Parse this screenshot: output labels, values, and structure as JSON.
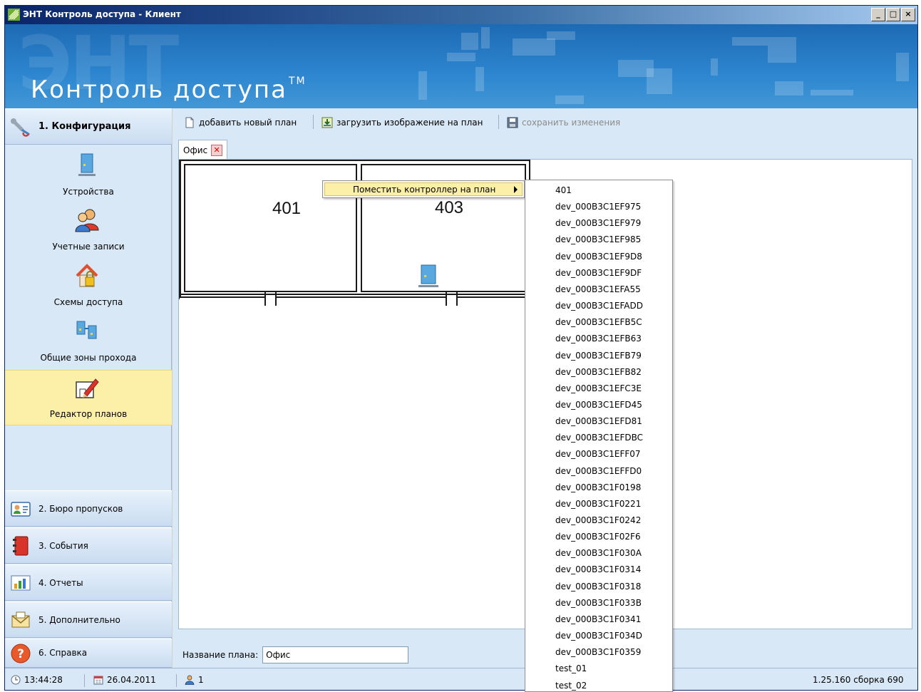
{
  "window": {
    "title": "ЭНТ Контроль доступа - Клиент",
    "controls": [
      "_",
      "□",
      "×"
    ]
  },
  "banner": {
    "logo": "Контроль доступа",
    "tm": "TM",
    "ghost": "ЭНТ"
  },
  "sidebar": {
    "active_section": "1. Конфигурация",
    "tools": [
      {
        "label": "Устройства",
        "icon": "server-icon"
      },
      {
        "label": "Учетные записи",
        "icon": "users-icon"
      },
      {
        "label": "Схемы доступа",
        "icon": "house-lock-icon"
      },
      {
        "label": "Общие зоны прохода",
        "icon": "network-icon"
      },
      {
        "label": "Редактор планов",
        "icon": "plan-editor-icon"
      }
    ],
    "sections": [
      {
        "label": "2. Бюро пропусков",
        "icon": "id-card-icon"
      },
      {
        "label": "3. События",
        "icon": "book-icon"
      },
      {
        "label": "4. Отчеты",
        "icon": "chart-icon"
      },
      {
        "label": "5. Дополнительно",
        "icon": "envelope-icon"
      },
      {
        "label": "6. Справка",
        "icon": "help-icon"
      }
    ]
  },
  "toolbar": {
    "add_plan": "добавить новый план",
    "load_image": "загрузить изображение на план",
    "save_changes": "сохранить изменения"
  },
  "tabs": [
    {
      "label": "Офис"
    }
  ],
  "plan": {
    "rooms": [
      "401",
      "403"
    ]
  },
  "context_menu": {
    "item": "Поместить контроллер на план"
  },
  "submenu_items": [
    "401",
    "dev_000B3C1EF975",
    "dev_000B3C1EF979",
    "dev_000B3C1EF985",
    "dev_000B3C1EF9D8",
    "dev_000B3C1EF9DF",
    "dev_000B3C1EFA55",
    "dev_000B3C1EFADD",
    "dev_000B3C1EFB5C",
    "dev_000B3C1EFB63",
    "dev_000B3C1EFB79",
    "dev_000B3C1EFB82",
    "dev_000B3C1EFC3E",
    "dev_000B3C1EFD45",
    "dev_000B3C1EFD81",
    "dev_000B3C1EFDBC",
    "dev_000B3C1EFF07",
    "dev_000B3C1EFFD0",
    "dev_000B3C1F0198",
    "dev_000B3C1F0221",
    "dev_000B3C1F0242",
    "dev_000B3C1F02F6",
    "dev_000B3C1F030A",
    "dev_000B3C1F0314",
    "dev_000B3C1F0318",
    "dev_000B3C1F033B",
    "dev_000B3C1F0341",
    "dev_000B3C1F034D",
    "dev_000B3C1F0359",
    "test_01",
    "test_02"
  ],
  "plan_name": {
    "label": "Название плана:",
    "value": "Офис"
  },
  "status": {
    "time": "13:44:28",
    "date": "26.04.2011",
    "users": "1",
    "version": "1.25.160 сборка 690"
  },
  "colors": {
    "banner": "#2d86cf",
    "panel": "#d9e8f6",
    "highlight": "#fcf0a8"
  }
}
